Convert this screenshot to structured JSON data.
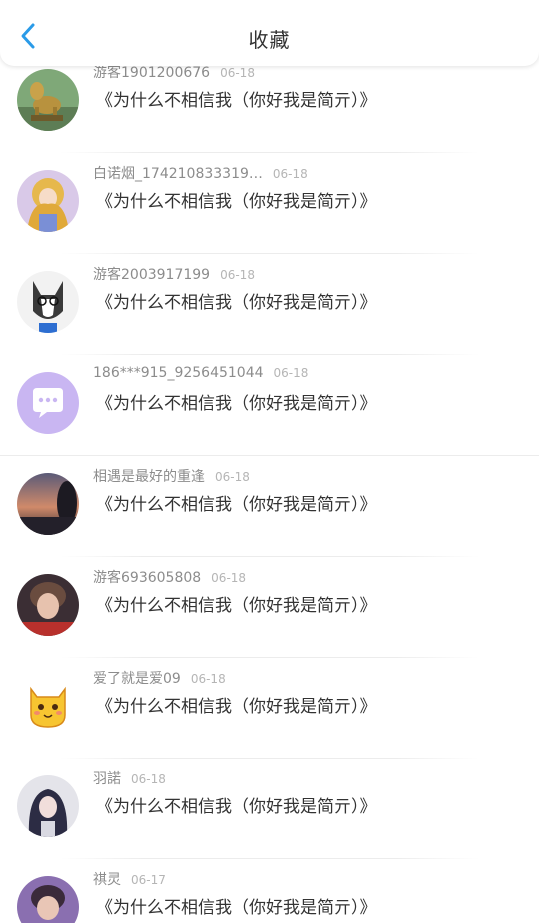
{
  "header": {
    "title": "收藏",
    "back_icon": "chevron-left-icon",
    "accent": "#2a9be8"
  },
  "items": [
    {
      "name": "游客1901200676",
      "date": "06-18",
      "content": "《为什么不相信我（你好我是简亓）》",
      "avatar": "bronze-dog-statue"
    },
    {
      "name": "白诺烟_174210833319…",
      "date": "06-18",
      "content": "《为什么不相信我（你好我是简亓）》",
      "avatar": "anime-girl-golden"
    },
    {
      "name": "游客2003917199",
      "date": "06-18",
      "content": "《为什么不相信我（你好我是简亓）》",
      "avatar": "husky-with-glasses"
    },
    {
      "name": "186***915_9256451044",
      "date": "06-18",
      "content": "《为什么不相信我（你好我是简亓）》",
      "avatar": "default-chat-bubble"
    },
    {
      "name": "相遇是最好的重逢",
      "date": "06-18",
      "content": "《为什么不相信我（你好我是简亓）》",
      "avatar": "sunset-silhouette"
    },
    {
      "name": "游客693605808",
      "date": "06-18",
      "content": "《为什么不相信我（你好我是简亓）》",
      "avatar": "person-photo"
    },
    {
      "name": "爱了就是爱09",
      "date": "06-18",
      "content": "《为什么不相信我（你好我是简亓）》",
      "avatar": "yellow-cartoon-cat"
    },
    {
      "name": "羽諾",
      "date": "06-18",
      "content": "《为什么不相信我（你好我是简亓）》",
      "avatar": "anime-dark-hair"
    },
    {
      "name": "祺灵",
      "date": "06-17",
      "content": "《为什么不相信我（你好我是简亓）》",
      "avatar": "person-photo-2"
    }
  ]
}
